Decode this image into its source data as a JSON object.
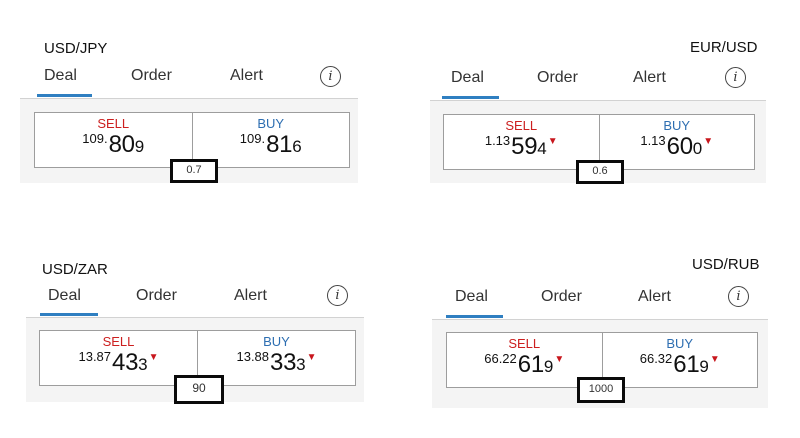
{
  "tabs": {
    "deal": "Deal",
    "order": "Order",
    "alert": "Alert",
    "info_glyph": "i"
  },
  "labels": {
    "sell": "SELL",
    "buy": "BUY"
  },
  "colors": {
    "sell": "#cc1f1f",
    "buy": "#2d6eb1",
    "tab_underline": "#2f7fc1",
    "down_arrow": "#c8161d"
  },
  "icons": {
    "info": "info-circle-icon",
    "direction": "down-triangle-icon"
  },
  "down_arrow_glyph": "▼",
  "widgets": [
    {
      "pair": "USD/JPY",
      "sell": {
        "small": "109.",
        "big": "80",
        "pip": "9",
        "arrow": false
      },
      "buy": {
        "small": "109.",
        "big": "81",
        "pip": "6",
        "arrow": false
      },
      "spread": "0.7"
    },
    {
      "pair": "EUR/USD",
      "sell": {
        "small": "1.13",
        "big": "59",
        "pip": "4",
        "arrow": true
      },
      "buy": {
        "small": "1.13",
        "big": "60",
        "pip": "0",
        "arrow": true
      },
      "spread": "0.6"
    },
    {
      "pair": "USD/ZAR",
      "sell": {
        "small": "13.87",
        "big": "43",
        "pip": "3",
        "arrow": true
      },
      "buy": {
        "small": "13.88",
        "big": "33",
        "pip": "3",
        "arrow": true
      },
      "spread": "90"
    },
    {
      "pair": "USD/RUB",
      "sell": {
        "small": "66.22",
        "big": "61",
        "pip": "9",
        "arrow": true
      },
      "buy": {
        "small": "66.32",
        "big": "61",
        "pip": "9",
        "arrow": true
      },
      "spread": "1000"
    }
  ]
}
